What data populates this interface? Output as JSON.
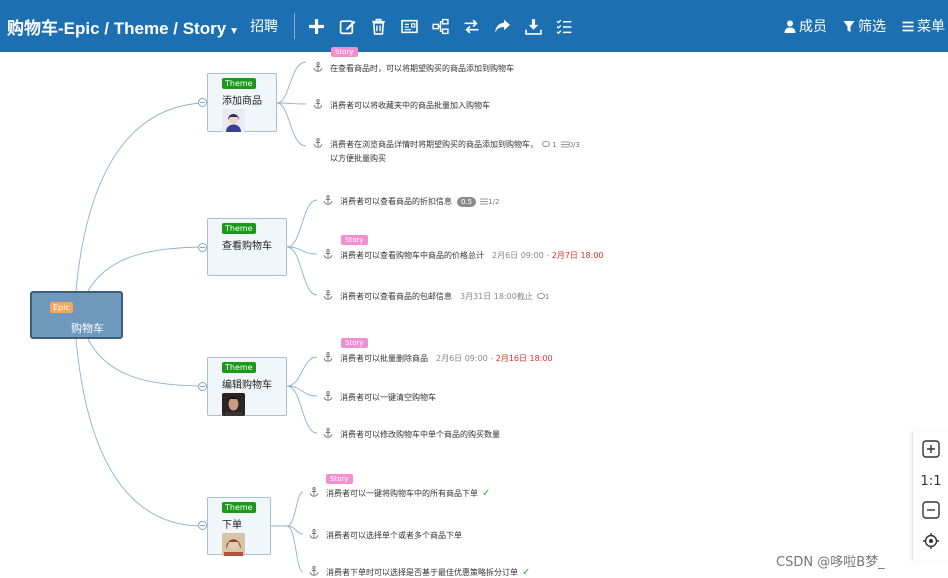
{
  "header": {
    "title": "购物车-Epic / Theme / Story",
    "hire": "招聘",
    "members": "成员",
    "filter": "筛选",
    "menu": "菜单"
  },
  "colors": {
    "header_bg": "#1c6fb0",
    "epic_tag": "#f6a65a",
    "theme_tag": "#1a9a1a",
    "story_tag": "#f28fd0",
    "root_node": "#6e99bc",
    "overdue": "#d9342b",
    "done": "#2fa845"
  },
  "root": {
    "tag": "Epic",
    "label": "购物车"
  },
  "themes": [
    {
      "tag": "Theme",
      "label": "添加商品",
      "stories": [
        {
          "text": "在查看商品时，可以将期望购买的商品添加到购物车",
          "story_tag": "Story"
        },
        {
          "text": "消费者可以将收藏夹中的商品批量加入购物车"
        },
        {
          "text": "消费者在浏览商品详情时将期望购买的商品添加到购物车，",
          "text2": "以方便批量购买",
          "comments": "1",
          "checklist": "0/3"
        }
      ]
    },
    {
      "tag": "Theme",
      "label": "查看购物车",
      "stories": [
        {
          "text": "消费者可以查看商品的折扣信息",
          "points": "0.5",
          "checklist": "1/2"
        },
        {
          "text": "消费者可以查看购物车中商品的价格总计",
          "story_tag": "Story",
          "start": "2月6日 09:00 - ",
          "due": "2月7日 18:00"
        },
        {
          "text": "消费者可以查看商品的包邮信息",
          "deadline": "3月31日 18:00截止",
          "comments": "1"
        }
      ]
    },
    {
      "tag": "Theme",
      "label": "编辑购物车",
      "stories": [
        {
          "text": "消费者可以批量删除商品",
          "story_tag": "Story",
          "start": "2月6日 09:00 - ",
          "due": "2月16日 18:00"
        },
        {
          "text": "消费者可以一键清空购物车"
        },
        {
          "text": "消费者可以修改购物车中单个商品的购买数量"
        }
      ]
    },
    {
      "tag": "Theme",
      "label": "下单",
      "stories": [
        {
          "text": "消费者可以一键将购物车中的所有商品下单",
          "story_tag": "Story",
          "done": "✓"
        },
        {
          "text": "消费者可以选择单个或者多个商品下单"
        },
        {
          "text": "消费者下单时可以选择是否基于最佳优惠策略拆分订单",
          "done": "✓"
        }
      ]
    }
  ],
  "zoom": {
    "reset": "1:1"
  },
  "watermark": "CSDN @哆啦B梦_"
}
